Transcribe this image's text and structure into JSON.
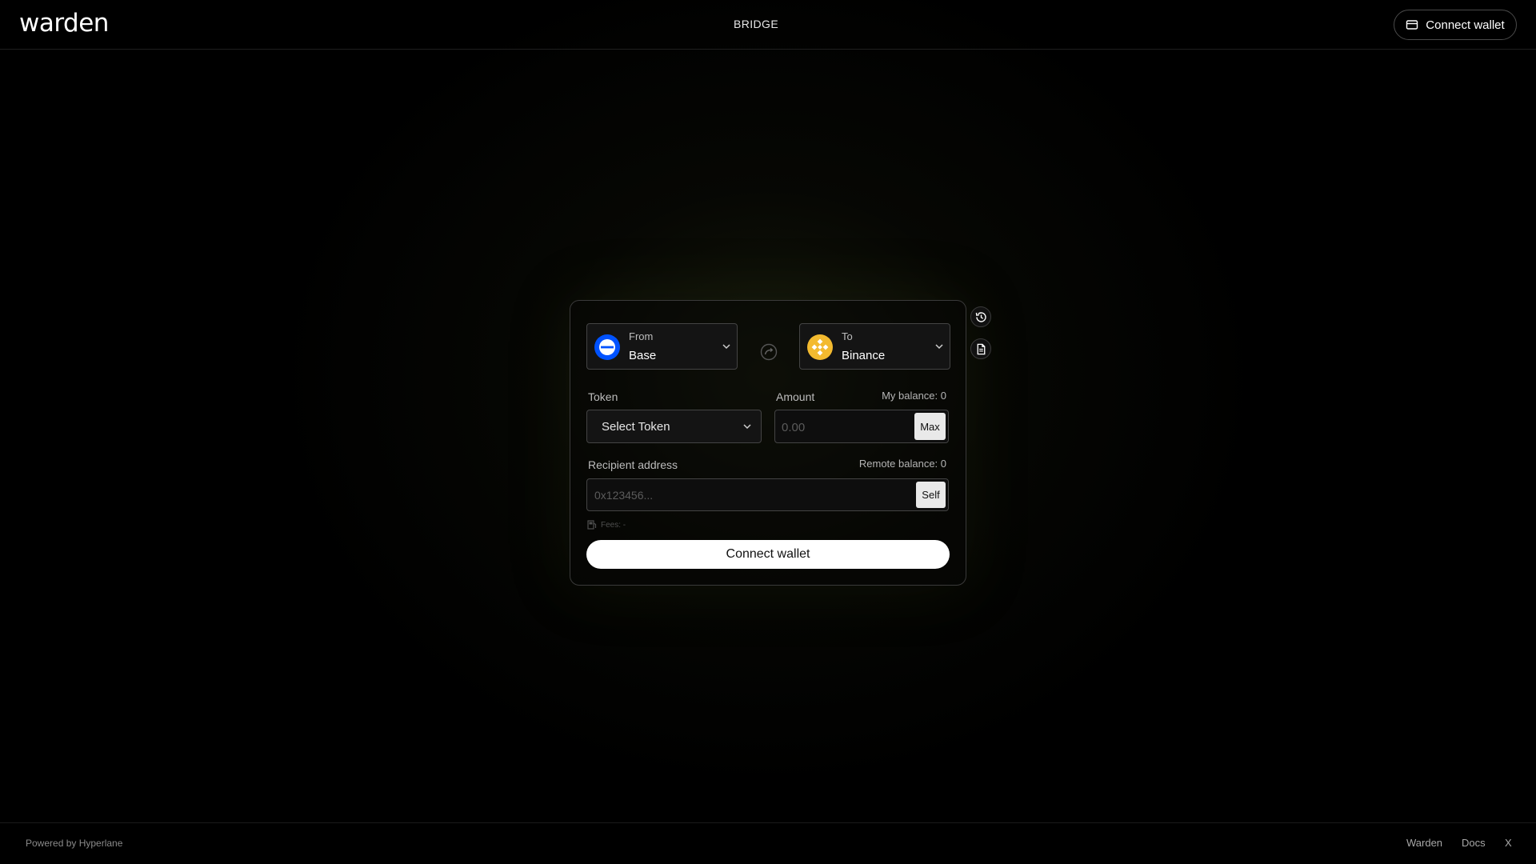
{
  "header": {
    "logo": "warden",
    "nav_active": "BRIDGE",
    "connect_label": "Connect wallet"
  },
  "bridge": {
    "from": {
      "caption": "From",
      "chain": "Base",
      "icon": "base-chain-icon"
    },
    "to": {
      "caption": "To",
      "chain": "Binance",
      "icon": "binance-chain-icon"
    },
    "token": {
      "label": "Token",
      "placeholder": "Select Token"
    },
    "amount": {
      "label": "Amount",
      "balance": "My balance: 0",
      "placeholder": "0.00",
      "max_label": "Max"
    },
    "recipient": {
      "label": "Recipient address",
      "remote_balance": "Remote balance: 0",
      "placeholder": "0x123456...",
      "self_label": "Self"
    },
    "fees": "Fees: -",
    "connect_label": "Connect wallet"
  },
  "side_actions": {
    "history_icon": "history-icon",
    "docs_icon": "document-icon"
  },
  "footer": {
    "powered": "Powered by Hyperlane",
    "links": [
      "Warden",
      "Docs",
      "X"
    ]
  },
  "colors": {
    "background": "#000000",
    "base_blue": "#0052ff",
    "binance_yellow": "#f3ba2f",
    "button_white": "#ffffff"
  }
}
